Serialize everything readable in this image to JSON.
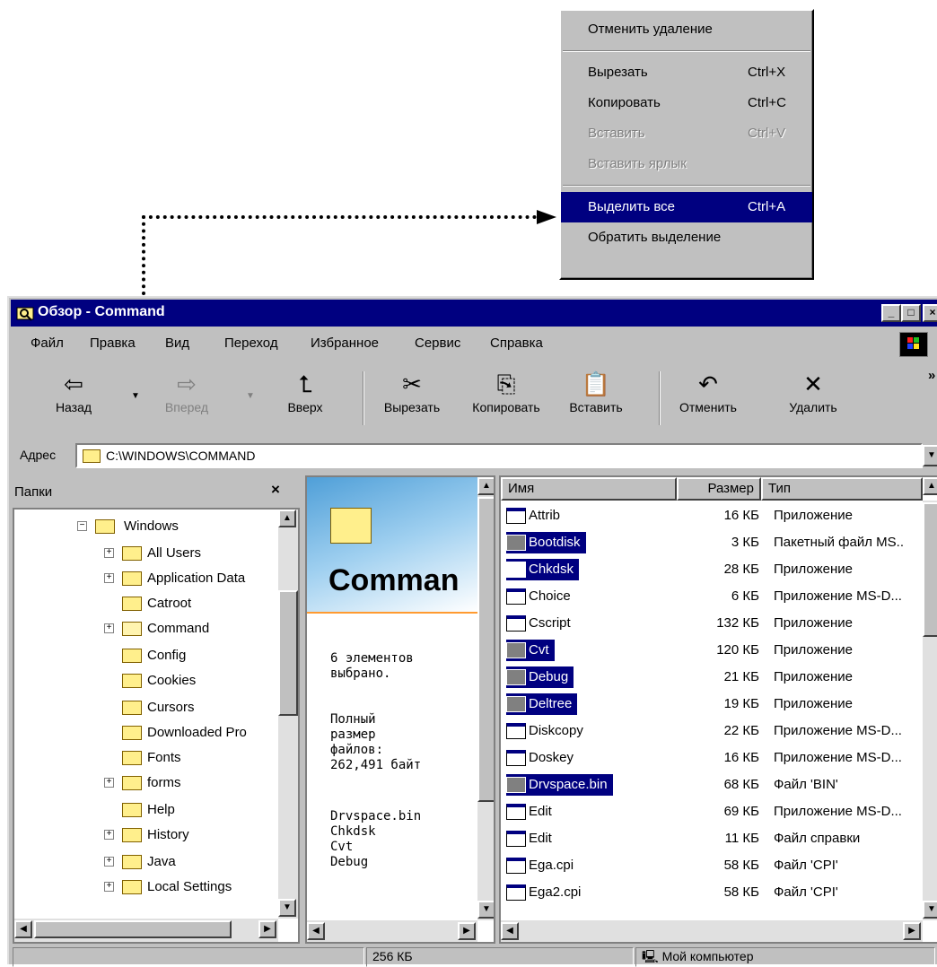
{
  "context_menu": {
    "items": [
      {
        "label": "Отменить удаление",
        "shortcut": "",
        "state": "normal"
      },
      {
        "label": "Вырезать",
        "shortcut": "Ctrl+X",
        "state": "normal"
      },
      {
        "label": "Копировать",
        "shortcut": "Ctrl+C",
        "state": "normal"
      },
      {
        "label": "Вставить",
        "shortcut": "Ctrl+V",
        "state": "disabled"
      },
      {
        "label": "Вставить ярлык",
        "shortcut": "",
        "state": "disabled"
      },
      {
        "label": "Выделить все",
        "shortcut": "Ctrl+A",
        "state": "highlighted"
      },
      {
        "label": "Обратить выделение",
        "shortcut": "",
        "state": "normal"
      }
    ]
  },
  "window": {
    "title": "Обзор - Command",
    "controls": {
      "minimize": "_",
      "maximize": "□",
      "close": "×"
    }
  },
  "menubar": [
    "Файл",
    "Правка",
    "Вид",
    "Переход",
    "Избранное",
    "Сервис",
    "Справка"
  ],
  "toolbar": {
    "back": "Назад",
    "forward": "Вперед",
    "up": "Вверх",
    "cut": "Вырезать",
    "copy": "Копировать",
    "paste": "Вставить",
    "undo": "Отменить",
    "delete": "Удалить",
    "more": "»"
  },
  "address": {
    "label": "Адрес",
    "value": "C:\\WINDOWS\\COMMAND"
  },
  "folders_pane": {
    "title": "Папки",
    "close": "×",
    "tree": [
      {
        "label": "Windows",
        "expander": "−",
        "level": 0
      },
      {
        "label": "All Users",
        "expander": "+",
        "level": 1
      },
      {
        "label": "Application Data",
        "expander": "+",
        "level": 1
      },
      {
        "label": "Catroot",
        "expander": "",
        "level": 1
      },
      {
        "label": "Command",
        "expander": "+",
        "level": 1
      },
      {
        "label": "Config",
        "expander": "",
        "level": 1
      },
      {
        "label": "Cookies",
        "expander": "",
        "level": 1
      },
      {
        "label": "Cursors",
        "expander": "",
        "level": 1
      },
      {
        "label": "Downloaded Pro",
        "expander": "",
        "level": 1
      },
      {
        "label": "Fonts",
        "expander": "",
        "level": 1
      },
      {
        "label": "forms",
        "expander": "+",
        "level": 1
      },
      {
        "label": "Help",
        "expander": "",
        "level": 1
      },
      {
        "label": "History",
        "expander": "+",
        "level": 1
      },
      {
        "label": "Java",
        "expander": "+",
        "level": 1
      },
      {
        "label": "Local Settings",
        "expander": "+",
        "level": 1
      }
    ]
  },
  "web_view": {
    "title": "Comman",
    "selected_count": "6 элементов\nвыбрано.",
    "total_size": "Полный\nразмер\nфайлов:\n262,491 байт",
    "selected_names": "Drvspace.bin\nChkdsk\nCvt\nDebug"
  },
  "file_list": {
    "columns": [
      "Имя",
      "Размер",
      "Тип"
    ],
    "rows": [
      {
        "name": "Attrib",
        "size": "16 КБ",
        "type": "Приложение",
        "selected": false,
        "icon": "app"
      },
      {
        "name": "Bootdisk",
        "size": "3 КБ",
        "type": "Пакетный файл MS..",
        "selected": true,
        "icon": "bat"
      },
      {
        "name": "Chkdsk",
        "size": "28 КБ",
        "type": "Приложение",
        "selected": true,
        "icon": "app"
      },
      {
        "name": "Choice",
        "size": "6 КБ",
        "type": "Приложение MS-D...",
        "selected": false,
        "icon": "app"
      },
      {
        "name": "Cscript",
        "size": "132 КБ",
        "type": "Приложение",
        "selected": false,
        "icon": "script"
      },
      {
        "name": "Cvt",
        "size": "120 КБ",
        "type": "Приложение",
        "selected": true,
        "icon": "bat"
      },
      {
        "name": "Debug",
        "size": "21 КБ",
        "type": "Приложение",
        "selected": true,
        "icon": "bat"
      },
      {
        "name": "Deltree",
        "size": "19 КБ",
        "type": "Приложение",
        "selected": true,
        "icon": "bat"
      },
      {
        "name": "Diskcopy",
        "size": "22 КБ",
        "type": "Приложение MS-D...",
        "selected": false,
        "icon": "app"
      },
      {
        "name": "Doskey",
        "size": "16 КБ",
        "type": "Приложение MS-D...",
        "selected": false,
        "icon": "app"
      },
      {
        "name": "Drvspace.bin",
        "size": "68 КБ",
        "type": "Файл 'BIN'",
        "selected": true,
        "icon": "bat"
      },
      {
        "name": "Edit",
        "size": "69 КБ",
        "type": "Приложение MS-D...",
        "selected": false,
        "icon": "app"
      },
      {
        "name": "Edit",
        "size": "11 КБ",
        "type": "Файл справки",
        "selected": false,
        "icon": "help"
      },
      {
        "name": "Ega.cpi",
        "size": "58 КБ",
        "type": "Файл 'CPI'",
        "selected": false,
        "icon": "doc"
      },
      {
        "name": "Ega2.cpi",
        "size": "58 КБ",
        "type": "Файл 'CPI'",
        "selected": false,
        "icon": "doc"
      }
    ]
  },
  "statusbar": {
    "size": "256 КБ",
    "zone": "Мой компьютер"
  }
}
